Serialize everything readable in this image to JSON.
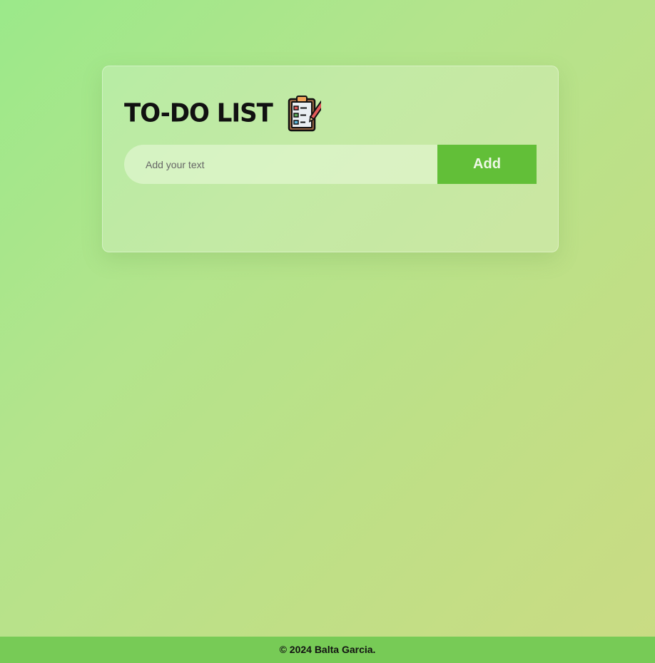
{
  "app": {
    "title": "TO-DO LIST",
    "title_icon": "clipboard-checklist-icon"
  },
  "input": {
    "placeholder": "Add your text",
    "value": ""
  },
  "add_button": {
    "label": "Add"
  },
  "tasks": [],
  "footer": {
    "text": "© 2024 Balta Garcia."
  },
  "colors": {
    "accent": "#62bf38",
    "footer_bg": "#77cb56",
    "background_start": "#9be98a",
    "background_end": "#cadb83"
  }
}
